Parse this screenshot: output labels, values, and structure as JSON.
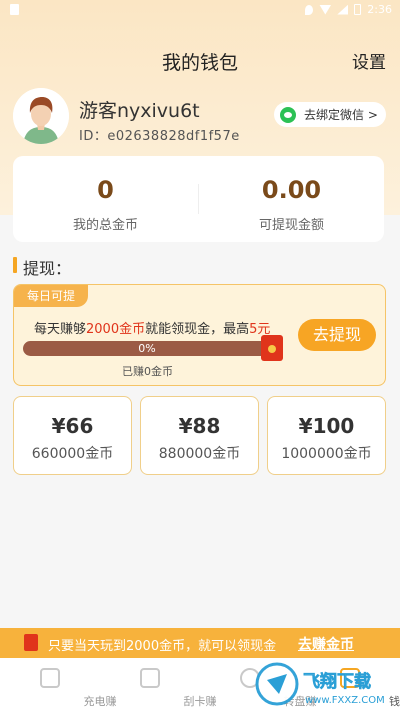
{
  "status_bar": {
    "time": "2:36"
  },
  "header": {
    "title": "我的钱包",
    "settings_label": "设置"
  },
  "user": {
    "name": "游客nyxivu6t",
    "id": "ID：e02638828df1f57e",
    "bind_wechat_label": "去绑定微信 >"
  },
  "stats": {
    "total_coins": {
      "value": "0",
      "label": "我的总金币"
    },
    "withdrawable": {
      "value": "0.00",
      "label": "可提现金额"
    }
  },
  "withdraw": {
    "section_title": "提现：",
    "daily_tag": "每日可提",
    "earn_prefix": "每天赚够",
    "earn_highlight": "2000金币",
    "earn_middle": "就能领现金，最高",
    "earn_max": "5元",
    "progress_percent": "0%",
    "progress_fraction": 0,
    "earned_label": "已赚0金币",
    "go_button": "去提现"
  },
  "amount_options": [
    {
      "price": "¥66",
      "coins": "660000金币"
    },
    {
      "price": "¥88",
      "coins": "880000金币"
    },
    {
      "price": "¥100",
      "coins": "1000000金币"
    }
  ],
  "bottom_banner": {
    "text": "只要当天玩到2000金币，就可以领现金",
    "link": "去赚金币"
  },
  "tabbar": [
    {
      "label": "充电赚",
      "icon": "battery-icon"
    },
    {
      "label": "刮卡赚",
      "icon": "ticket-icon"
    },
    {
      "label": "转盘赚",
      "icon": "wheel-icon"
    },
    {
      "label": "钱包",
      "icon": "wallet-icon"
    }
  ],
  "watermark": {
    "text": "飞翔下载",
    "url": "www.FXXZ.COM"
  },
  "colors": {
    "accent": "#f7a524",
    "highlight": "#e0341b",
    "coin_text": "#7a4a1a"
  }
}
